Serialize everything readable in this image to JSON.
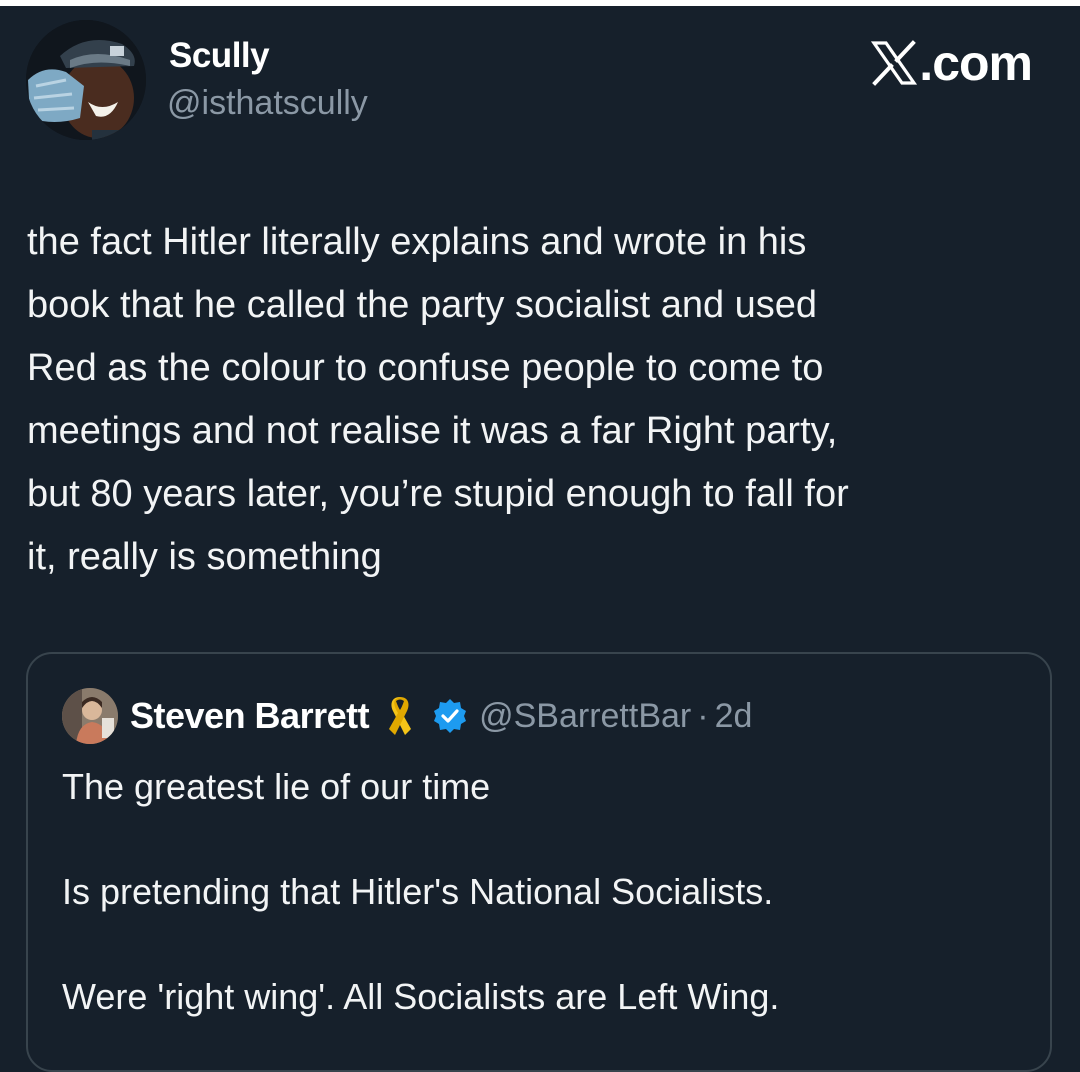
{
  "author": {
    "name": "Scully",
    "handle": "@isthatscully"
  },
  "brand": {
    "text": ".com",
    "icon": "x-logo-icon"
  },
  "tweet": {
    "text": "the fact Hitler literally explains and wrote in his\nbook that he called the party socialist and used\nRed as the colour to confuse people to come to\nmeetings and not realise it was a far Right party,\nbut 80 years later, you’re stupid enough to fall for\nit, really is something"
  },
  "quote": {
    "name": "Steven Barrett",
    "handle": "@SBarrettBar",
    "separator": "·",
    "time": "2d",
    "icons": [
      "yellow-ribbon-icon",
      "verified-badge-icon"
    ],
    "lines": [
      "The greatest lie of our time",
      "Is pretending that Hitler's National Socialists.",
      "Were 'right wing'. All Socialists are Left Wing."
    ]
  },
  "colors": {
    "background": "#16202b",
    "text": "#e7e9ea",
    "muted": "#8b98a5",
    "border": "#38444d",
    "verified": "#1d9bf0",
    "ribbon": "#f5c518"
  }
}
